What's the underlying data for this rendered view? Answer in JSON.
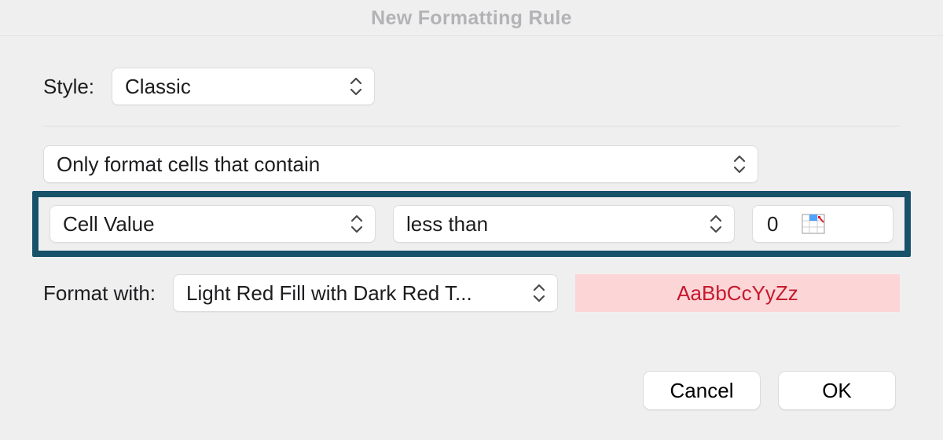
{
  "title": "New Formatting Rule",
  "style": {
    "label": "Style:",
    "value": "Classic"
  },
  "rule_type": {
    "value": "Only format cells that contain"
  },
  "criteria": {
    "subject": "Cell Value",
    "operator": "less than",
    "value": "0"
  },
  "format": {
    "label": "Format with:",
    "preset": "Light Red Fill with Dark Red T...",
    "preview_text": "AaBbCcYyZz",
    "preview_fill": "#fcd6d7",
    "preview_text_color": "#c6192e"
  },
  "buttons": {
    "cancel": "Cancel",
    "ok": "OK"
  }
}
